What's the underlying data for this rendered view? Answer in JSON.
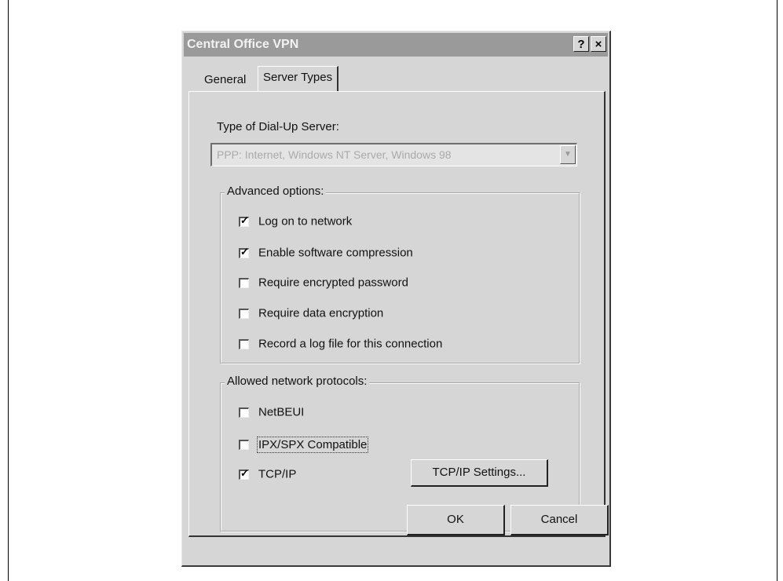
{
  "dialog": {
    "title": "Central Office VPN",
    "help_button": "?",
    "close_button": "×"
  },
  "tabs": [
    {
      "label": "General",
      "active": false
    },
    {
      "label": "Server Types",
      "active": true
    }
  ],
  "server_type": {
    "label": "Type of Dial-Up Server:",
    "value": "PPP: Internet, Windows NT Server, Windows 98",
    "disabled": true
  },
  "advanced": {
    "title": "Advanced options:",
    "options": [
      {
        "label": "Log on to network",
        "checked": true
      },
      {
        "label": "Enable software compression",
        "checked": true
      },
      {
        "label": "Require encrypted password",
        "checked": false
      },
      {
        "label": "Require data encryption",
        "checked": false
      },
      {
        "label": "Record a log file for this connection",
        "checked": false
      }
    ]
  },
  "protocols": {
    "title": "Allowed network protocols:",
    "options": [
      {
        "label": "NetBEUI",
        "checked": false
      },
      {
        "label": "IPX/SPX Compatible",
        "checked": false
      },
      {
        "label": "TCP/IP",
        "checked": true
      }
    ],
    "settings_button": "TCP/IP Settings..."
  },
  "footer": {
    "ok": "OK",
    "cancel": "Cancel"
  },
  "colors": {
    "dialog_bg": "#d6d6d6",
    "titlebar_bg": "#9a9a9a"
  }
}
